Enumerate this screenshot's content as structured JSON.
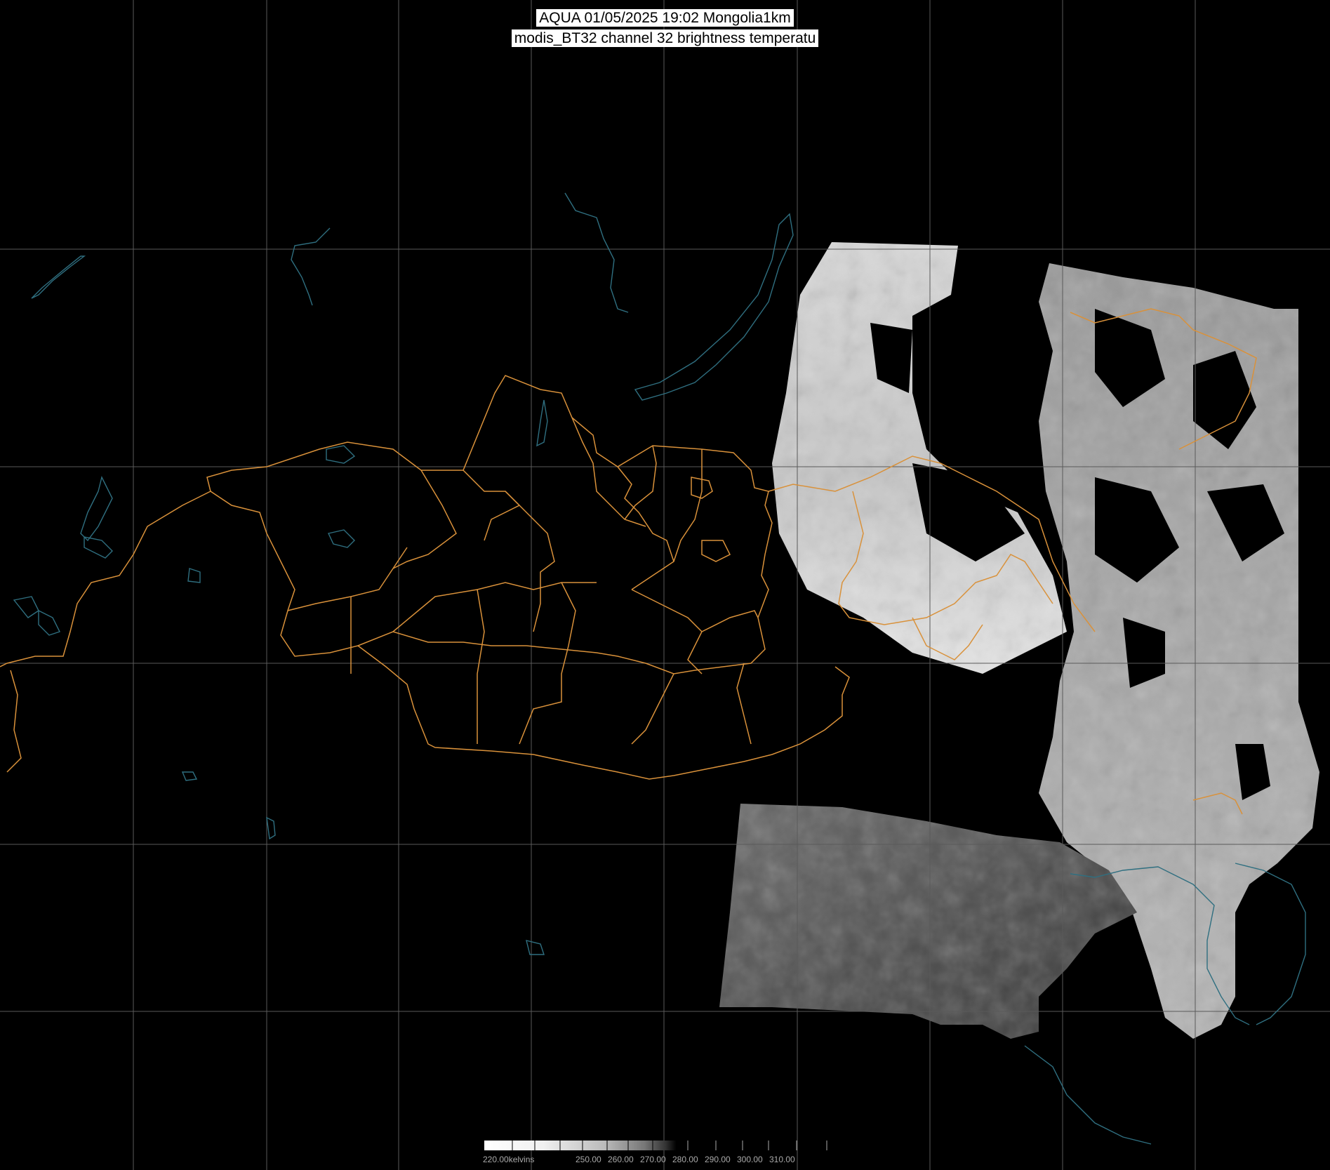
{
  "header": {
    "line1": "AQUA 01/05/2025 19:02 Mongolia1km",
    "line2": "modis_BT32 channel 32 brightness temperatu"
  },
  "colors": {
    "background": "#000000",
    "grid": "#5a5a5a",
    "border": "#d9913a",
    "water": "#2f6f80",
    "imagery_light": "#e0e0e0",
    "imagery_dark": "#3a3a3a"
  },
  "legend": {
    "tick_labels": [
      "220.00kelvins",
      "250.00",
      "260.00",
      "270.00",
      "280.00",
      "290.00",
      "300.00",
      "310.00"
    ]
  }
}
